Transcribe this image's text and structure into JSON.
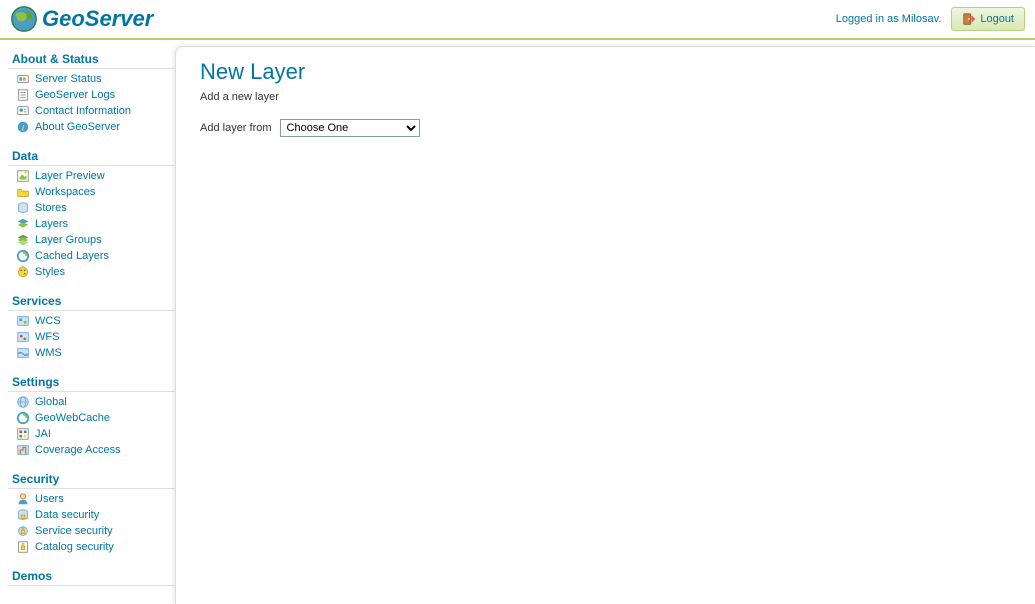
{
  "header": {
    "app_name": "GeoServer",
    "logged_in_text": "Logged in as Milosav.",
    "logout_label": "Logout"
  },
  "sidebar": {
    "sections": [
      {
        "heading": "About & Status",
        "items": [
          {
            "label": "Server Status",
            "icon": "status-icon"
          },
          {
            "label": "GeoServer Logs",
            "icon": "logs-icon"
          },
          {
            "label": "Contact Information",
            "icon": "contact-icon"
          },
          {
            "label": "About GeoServer",
            "icon": "about-icon"
          }
        ]
      },
      {
        "heading": "Data",
        "items": [
          {
            "label": "Layer Preview",
            "icon": "layer-preview-icon"
          },
          {
            "label": "Workspaces",
            "icon": "workspaces-icon"
          },
          {
            "label": "Stores",
            "icon": "stores-icon"
          },
          {
            "label": "Layers",
            "icon": "layers-icon"
          },
          {
            "label": "Layer Groups",
            "icon": "layer-groups-icon"
          },
          {
            "label": "Cached Layers",
            "icon": "cached-layers-icon"
          },
          {
            "label": "Styles",
            "icon": "styles-icon"
          }
        ]
      },
      {
        "heading": "Services",
        "items": [
          {
            "label": "WCS",
            "icon": "wcs-icon"
          },
          {
            "label": "WFS",
            "icon": "wfs-icon"
          },
          {
            "label": "WMS",
            "icon": "wms-icon"
          }
        ]
      },
      {
        "heading": "Settings",
        "items": [
          {
            "label": "Global",
            "icon": "global-icon"
          },
          {
            "label": "GeoWebCache",
            "icon": "geowebcache-icon"
          },
          {
            "label": "JAI",
            "icon": "jai-icon"
          },
          {
            "label": "Coverage Access",
            "icon": "coverage-access-icon"
          }
        ]
      },
      {
        "heading": "Security",
        "items": [
          {
            "label": "Users",
            "icon": "users-icon"
          },
          {
            "label": "Data security",
            "icon": "data-security-icon"
          },
          {
            "label": "Service security",
            "icon": "service-security-icon"
          },
          {
            "label": "Catalog security",
            "icon": "catalog-security-icon"
          }
        ]
      },
      {
        "heading": "Demos",
        "items": []
      }
    ]
  },
  "content": {
    "title": "New Layer",
    "description": "Add a new layer",
    "form": {
      "add_layer_label": "Add layer from",
      "select_placeholder": "Choose One"
    }
  }
}
